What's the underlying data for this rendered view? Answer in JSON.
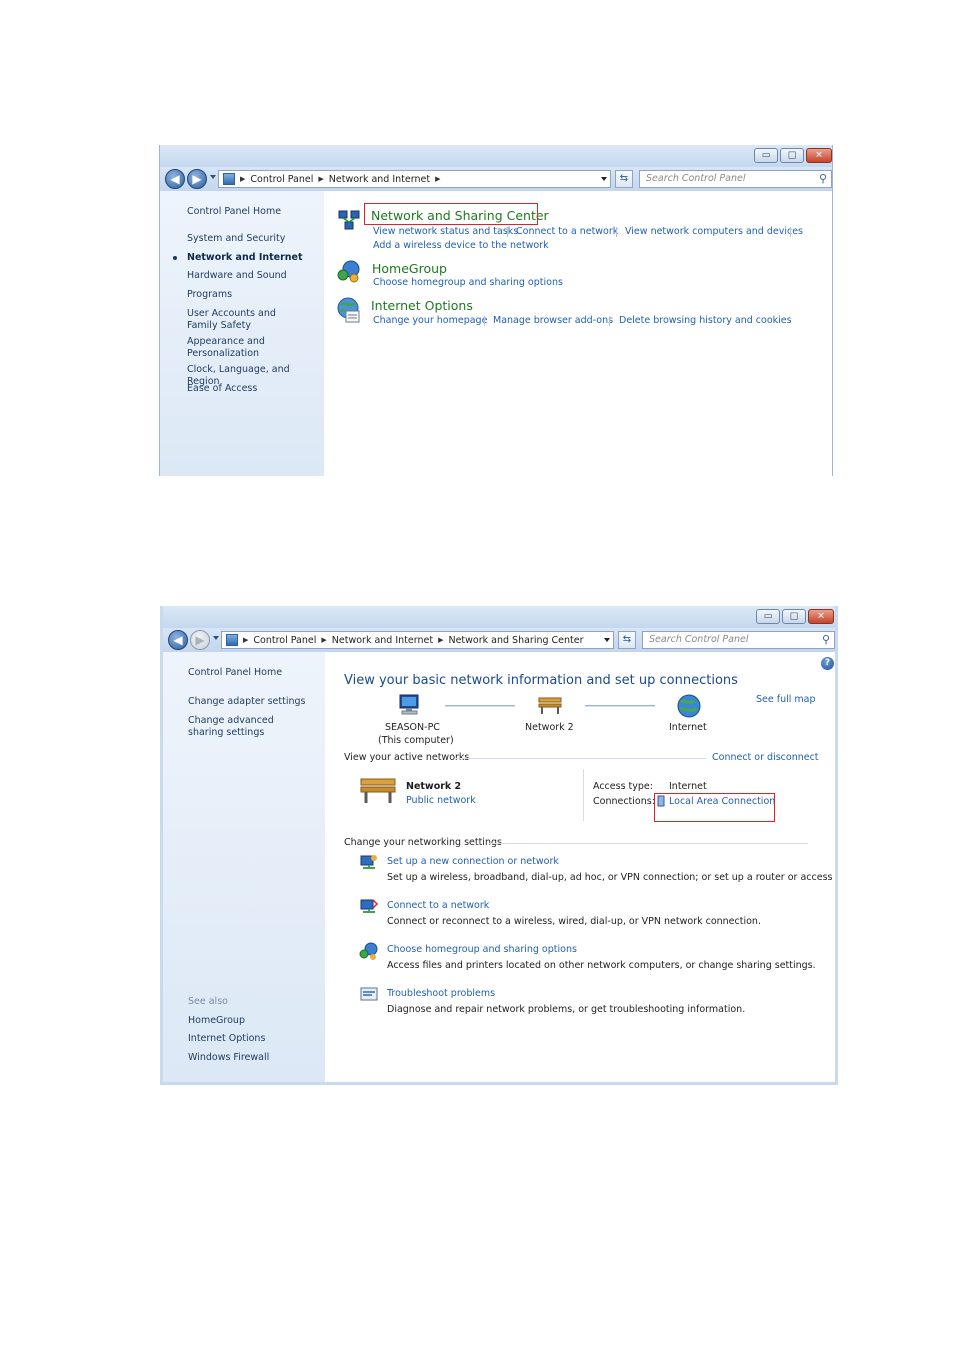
{
  "window1": {
    "controls": {
      "minimize": "▭",
      "maximize": "□",
      "close": "✕"
    },
    "breadcrumb": [
      "Control Panel",
      "Network and Internet"
    ],
    "search_placeholder": "Search Control Panel",
    "sidebar": {
      "home": "Control Panel Home",
      "items": [
        "System and Security",
        "Network and Internet",
        "Hardware and Sound",
        "Programs",
        "User Accounts and Family Safety",
        "Appearance and Personalization",
        "Clock, Language, and Region",
        "Ease of Access"
      ],
      "current_index": 1
    },
    "categories": [
      {
        "title": "Network and Sharing Center",
        "links": [
          "View network status and tasks",
          "Connect to a network",
          "View network computers and devices",
          "Add a wireless device to the network"
        ]
      },
      {
        "title": "HomeGroup",
        "links": [
          "Choose homegroup and sharing options"
        ]
      },
      {
        "title": "Internet Options",
        "links": [
          "Change your homepage",
          "Manage browser add-ons",
          "Delete browsing history and cookies"
        ]
      }
    ]
  },
  "window2": {
    "breadcrumb": [
      "Control Panel",
      "Network and Internet",
      "Network and Sharing Center"
    ],
    "search_placeholder": "Search Control Panel",
    "help": "?",
    "sidebar": {
      "home": "Control Panel Home",
      "links": [
        "Change adapter settings",
        "Change advanced sharing settings"
      ],
      "see_also_label": "See also",
      "see_also": [
        "HomeGroup",
        "Internet Options",
        "Windows Firewall"
      ]
    },
    "title": "View your basic network information and set up connections",
    "see_full_map": "See full map",
    "map": {
      "computer_name": "SEASON-PC",
      "computer_note": "(This computer)",
      "network": "Network  2",
      "internet": "Internet"
    },
    "active_networks_label": "View your active networks",
    "connect_disconnect": "Connect or disconnect",
    "active": {
      "name": "Network  2",
      "type": "Public network",
      "access_type_label": "Access type:",
      "access_type_value": "Internet",
      "connections_label": "Connections:",
      "connection_value": "Local Area Connection"
    },
    "settings_label": "Change your networking settings",
    "tasks": [
      {
        "link": "Set up a new connection or network",
        "desc": "Set up a wireless, broadband, dial-up, ad hoc, or VPN connection; or set up a router or access point."
      },
      {
        "link": "Connect to a network",
        "desc": "Connect or reconnect to a wireless, wired, dial-up, or VPN network connection."
      },
      {
        "link": "Choose homegroup and sharing options",
        "desc": "Access files and printers located on other network computers, or change sharing settings."
      },
      {
        "link": "Troubleshoot problems",
        "desc": "Diagnose and repair network problems, or get troubleshooting information."
      }
    ]
  }
}
